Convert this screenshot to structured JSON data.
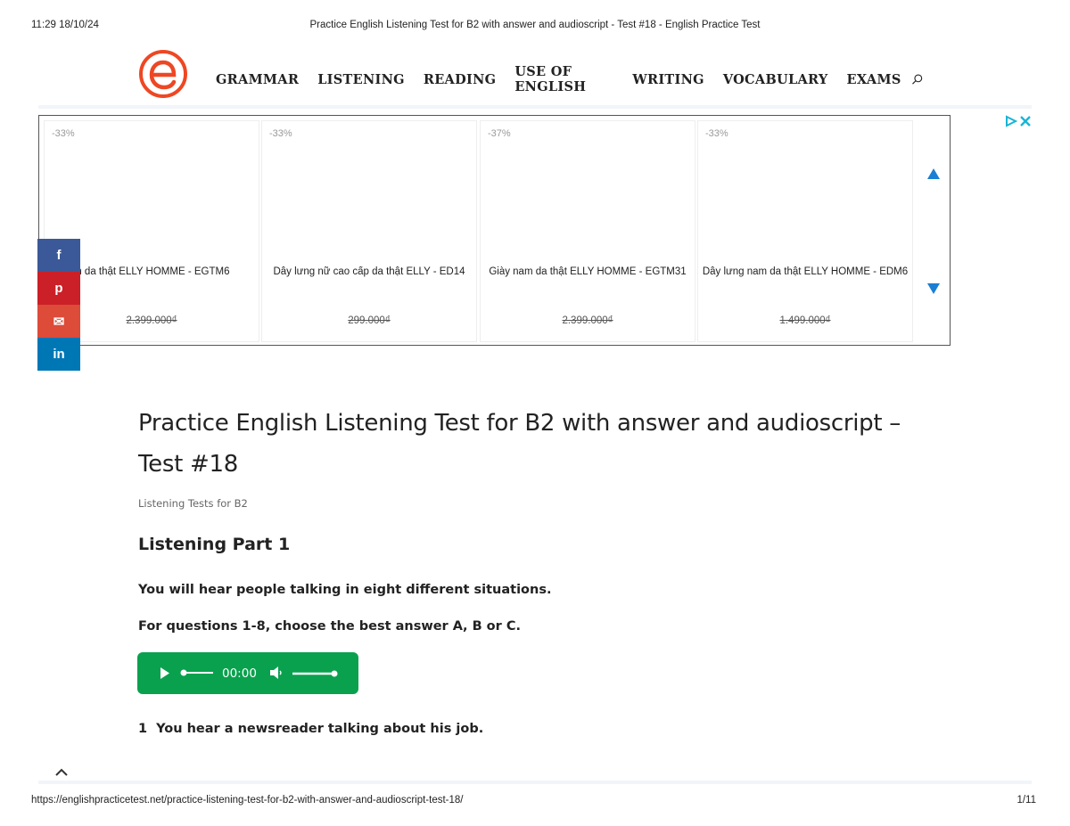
{
  "print": {
    "datetime": "11:29 18/10/24",
    "title": "Practice English Listening Test for B2 with answer and audioscript - Test #18 - English Practice Test",
    "url": "https://englishpracticetest.net/practice-listening-test-for-b2-with-answer-and-audioscript-test-18/",
    "page": "1/11"
  },
  "nav": [
    "GRAMMAR",
    "LISTENING",
    "READING",
    "USE OF ENGLISH",
    "WRITING",
    "VOCABULARY",
    "EXAMS"
  ],
  "brand_color": "#ee4723",
  "ad": {
    "items": [
      {
        "discount": "-33%",
        "name": "Giày nam da thật ELLY HOMME - EGTM6",
        "price": "2.399.000₫"
      },
      {
        "discount": "-33%",
        "name": "Dây lưng nữ cao cấp da thật ELLY - ED14",
        "price": "299.000₫"
      },
      {
        "discount": "-37%",
        "name": "Giày nam da thật ELLY HOMME - EGTM31",
        "price": "2.399.000₫"
      },
      {
        "discount": "-33%",
        "name": "Dây lưng nam da thật ELLY HOMME - EDM6",
        "price": "1.499.000₫"
      }
    ]
  },
  "share": {
    "facebook": "f",
    "pinterest": "p",
    "email": "✉",
    "linkedin": "in"
  },
  "article": {
    "title": "Practice English Listening Test for B2 with answer and audioscript – Test #18",
    "category": "Listening Tests for B2",
    "part_heading": "Listening Part 1",
    "intro": "You will hear people talking in eight different situations.",
    "instruction_pre": "For questions ",
    "instruction_range": "1-8",
    "instruction_mid": ", choose the best answer ",
    "opt_a": "A",
    "opt_sep1": ", ",
    "opt_b": "B",
    "opt_sep2": " or ",
    "opt_c": "C",
    "instruction_end": ".",
    "player_time": "00:00",
    "player_color": "#0aa14e",
    "q1_num": "1",
    "q1_text": "You hear a newsreader talking about his job."
  }
}
